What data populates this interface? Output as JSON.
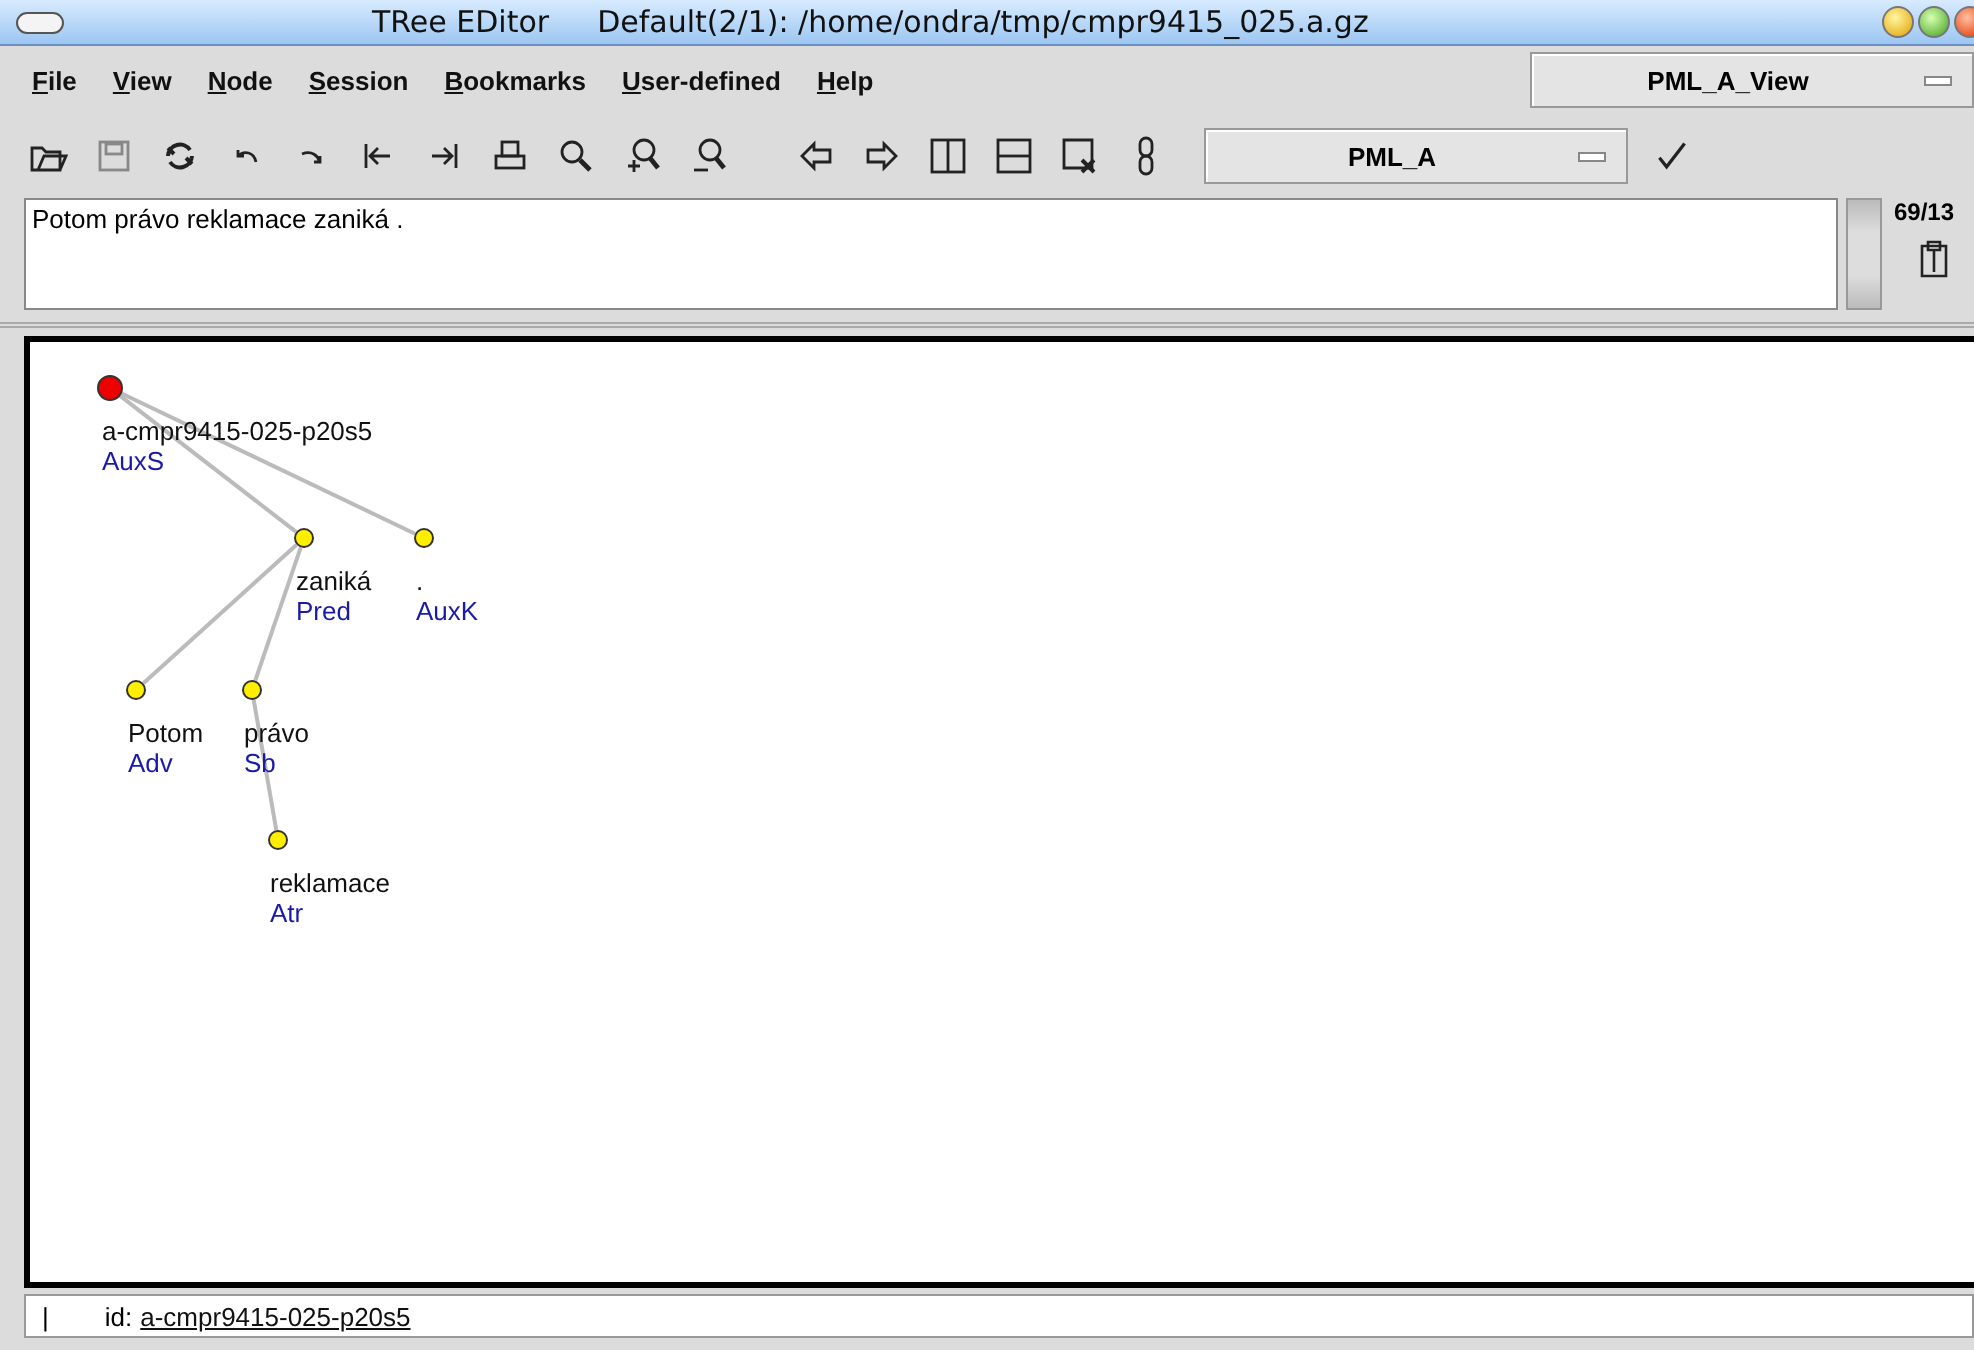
{
  "window": {
    "app_name": "TRee EDitor",
    "title": "Default(2/1): /home/ondra/tmp/cmpr9415_025.a.gz"
  },
  "menu": [
    "File",
    "View",
    "Node",
    "Session",
    "Bookmarks",
    "User-defined",
    "Help"
  ],
  "view_select": "PML_A_View",
  "toolbar_select": "PML_A",
  "sentence": "Potom právo reklamace zaniká .",
  "tree_counter": "69/13",
  "tree": {
    "label": "a-cmpr9415-025-p20s5",
    "afun": "AuxS",
    "selected": true,
    "children": [
      {
        "label": "zaniká",
        "afun": "Pred",
        "selected": false,
        "children": [
          {
            "label": "Potom",
            "afun": "Adv",
            "selected": false
          },
          {
            "label": "právo",
            "afun": "Sb",
            "selected": false,
            "children": [
              {
                "label": "reklamace",
                "afun": "Atr",
                "selected": false
              }
            ]
          }
        ]
      },
      {
        "label": ".",
        "afun": "AuxK",
        "selected": false
      }
    ]
  },
  "status": {
    "cursor": "|",
    "id_label": "id:",
    "id_link": "a-cmpr9415-025-p20s5"
  }
}
